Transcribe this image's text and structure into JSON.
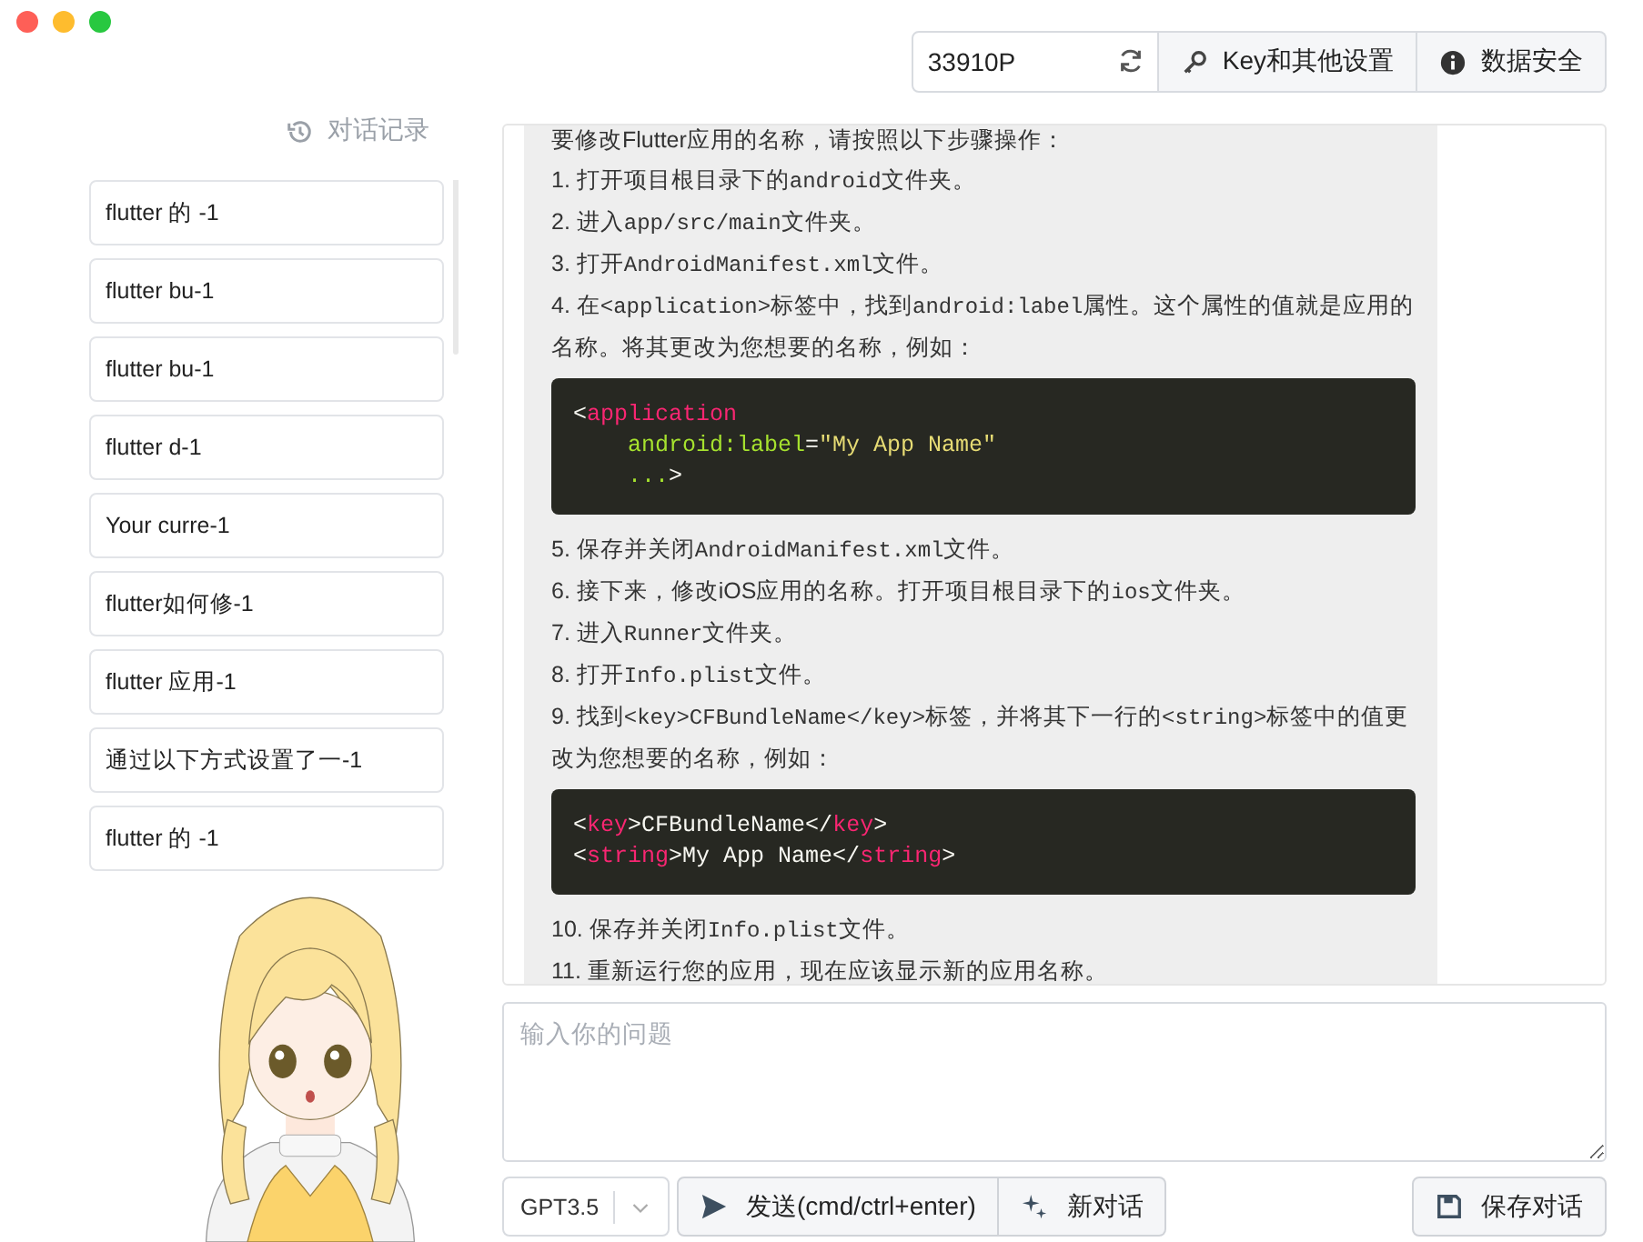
{
  "top_bar": {
    "token_field": {
      "value": "33910P"
    },
    "buttons": [
      {
        "label": "Key和其他设置",
        "kind": "key"
      },
      {
        "label": "数据安全",
        "kind": "info"
      }
    ]
  },
  "sidebar": {
    "title": "对话记录",
    "items": [
      {
        "label": "flutter 的 -1"
      },
      {
        "label": "flutter bu-1"
      },
      {
        "label": "flutter bu-1"
      },
      {
        "label": "flutter d-1"
      },
      {
        "label": "Your curre-1"
      },
      {
        "label": "flutter如何修-1"
      },
      {
        "label": "flutter 应用-1"
      },
      {
        "label": "通过以下方式设置了一-1"
      },
      {
        "label": "flutter 的 -1"
      }
    ]
  },
  "message": {
    "blocks": [
      {
        "kind": "text",
        "parts": [
          {
            "text": "要修改Flutter应用的名称，请按照以下步骤操作：",
            "code": false
          }
        ]
      },
      {
        "kind": "text",
        "parts": [
          {
            "text": "1. 打开项目根目录下的",
            "code": false
          },
          {
            "text": "android",
            "code": true
          },
          {
            "text": "文件夹。",
            "code": false
          }
        ]
      },
      {
        "kind": "text",
        "parts": [
          {
            "text": "2. 进入",
            "code": false
          },
          {
            "text": "app/src/main",
            "code": true
          },
          {
            "text": "文件夹。",
            "code": false
          }
        ]
      },
      {
        "kind": "text",
        "parts": [
          {
            "text": "3. 打开",
            "code": false
          },
          {
            "text": "AndroidManifest.xml",
            "code": true
          },
          {
            "text": "文件。",
            "code": false
          }
        ]
      },
      {
        "kind": "text",
        "parts": [
          {
            "text": "4. 在",
            "code": false
          },
          {
            "text": "<application>",
            "code": true
          },
          {
            "text": "标签中，找到",
            "code": false
          },
          {
            "text": "android:label",
            "code": true
          },
          {
            "text": "属性。这个属性的值就是应用的名称。将其更改为您想要的名称，例如：",
            "code": false
          }
        ]
      },
      {
        "kind": "code",
        "lines": [
          [
            {
              "text": "<",
              "kind": "punct"
            },
            {
              "text": "application",
              "kind": "tag"
            }
          ],
          [
            {
              "text": "    android:label",
              "kind": "attr"
            },
            {
              "text": "=",
              "kind": "punct"
            },
            {
              "text": "\"My App Name\"",
              "kind": "string"
            }
          ],
          [
            {
              "text": "    ...",
              "kind": "attr"
            },
            {
              "text": ">",
              "kind": "punct"
            }
          ]
        ]
      },
      {
        "kind": "text",
        "parts": [
          {
            "text": "5. 保存并关闭",
            "code": false
          },
          {
            "text": "AndroidManifest.xml",
            "code": true
          },
          {
            "text": "文件。",
            "code": false
          }
        ]
      },
      {
        "kind": "text",
        "parts": [
          {
            "text": "6. 接下来，修改iOS应用的名称。打开项目根目录下的",
            "code": false
          },
          {
            "text": "ios",
            "code": true
          },
          {
            "text": "文件夹。",
            "code": false
          }
        ]
      },
      {
        "kind": "text",
        "parts": [
          {
            "text": "7. 进入",
            "code": false
          },
          {
            "text": "Runner",
            "code": true
          },
          {
            "text": "文件夹。",
            "code": false
          }
        ]
      },
      {
        "kind": "text",
        "parts": [
          {
            "text": "8. 打开",
            "code": false
          },
          {
            "text": "Info.plist",
            "code": true
          },
          {
            "text": "文件。",
            "code": false
          }
        ]
      },
      {
        "kind": "text",
        "parts": [
          {
            "text": "9. 找到",
            "code": false
          },
          {
            "text": "<key>CFBundleName</key>",
            "code": true
          },
          {
            "text": "标签，并将其下一行的",
            "code": false
          },
          {
            "text": "<string>",
            "code": true
          },
          {
            "text": "标签中的值更改为您想要的名称，例如：",
            "code": false
          }
        ]
      },
      {
        "kind": "code",
        "lines": [
          [
            {
              "text": "<",
              "kind": "punct"
            },
            {
              "text": "key",
              "kind": "tag"
            },
            {
              "text": ">CFBundleName</",
              "kind": "punct"
            },
            {
              "text": "key",
              "kind": "tag"
            },
            {
              "text": ">",
              "kind": "punct"
            }
          ],
          [
            {
              "text": "<",
              "kind": "punct"
            },
            {
              "text": "string",
              "kind": "tag"
            },
            {
              "text": ">My App Name</",
              "kind": "punct"
            },
            {
              "text": "string",
              "kind": "tag"
            },
            {
              "text": ">",
              "kind": "punct"
            }
          ]
        ]
      },
      {
        "kind": "text",
        "parts": [
          {
            "text": "10. 保存并关闭",
            "code": false
          },
          {
            "text": "Info.plist",
            "code": true
          },
          {
            "text": "文件。",
            "code": false
          }
        ]
      },
      {
        "kind": "text",
        "parts": [
          {
            "text": "11. 重新运行您的应用，现在应该显示新的应用名称。",
            "code": false
          }
        ]
      }
    ]
  },
  "input": {
    "placeholder": "输入你的问题"
  },
  "bottom_bar": {
    "model_select": {
      "value": "GPT3.5"
    },
    "buttons": [
      {
        "label": "发送(cmd/ctrl+enter)",
        "kind": "send"
      },
      {
        "label": "新对话",
        "kind": "new"
      },
      {
        "label": "保存对话",
        "kind": "save"
      }
    ]
  }
}
